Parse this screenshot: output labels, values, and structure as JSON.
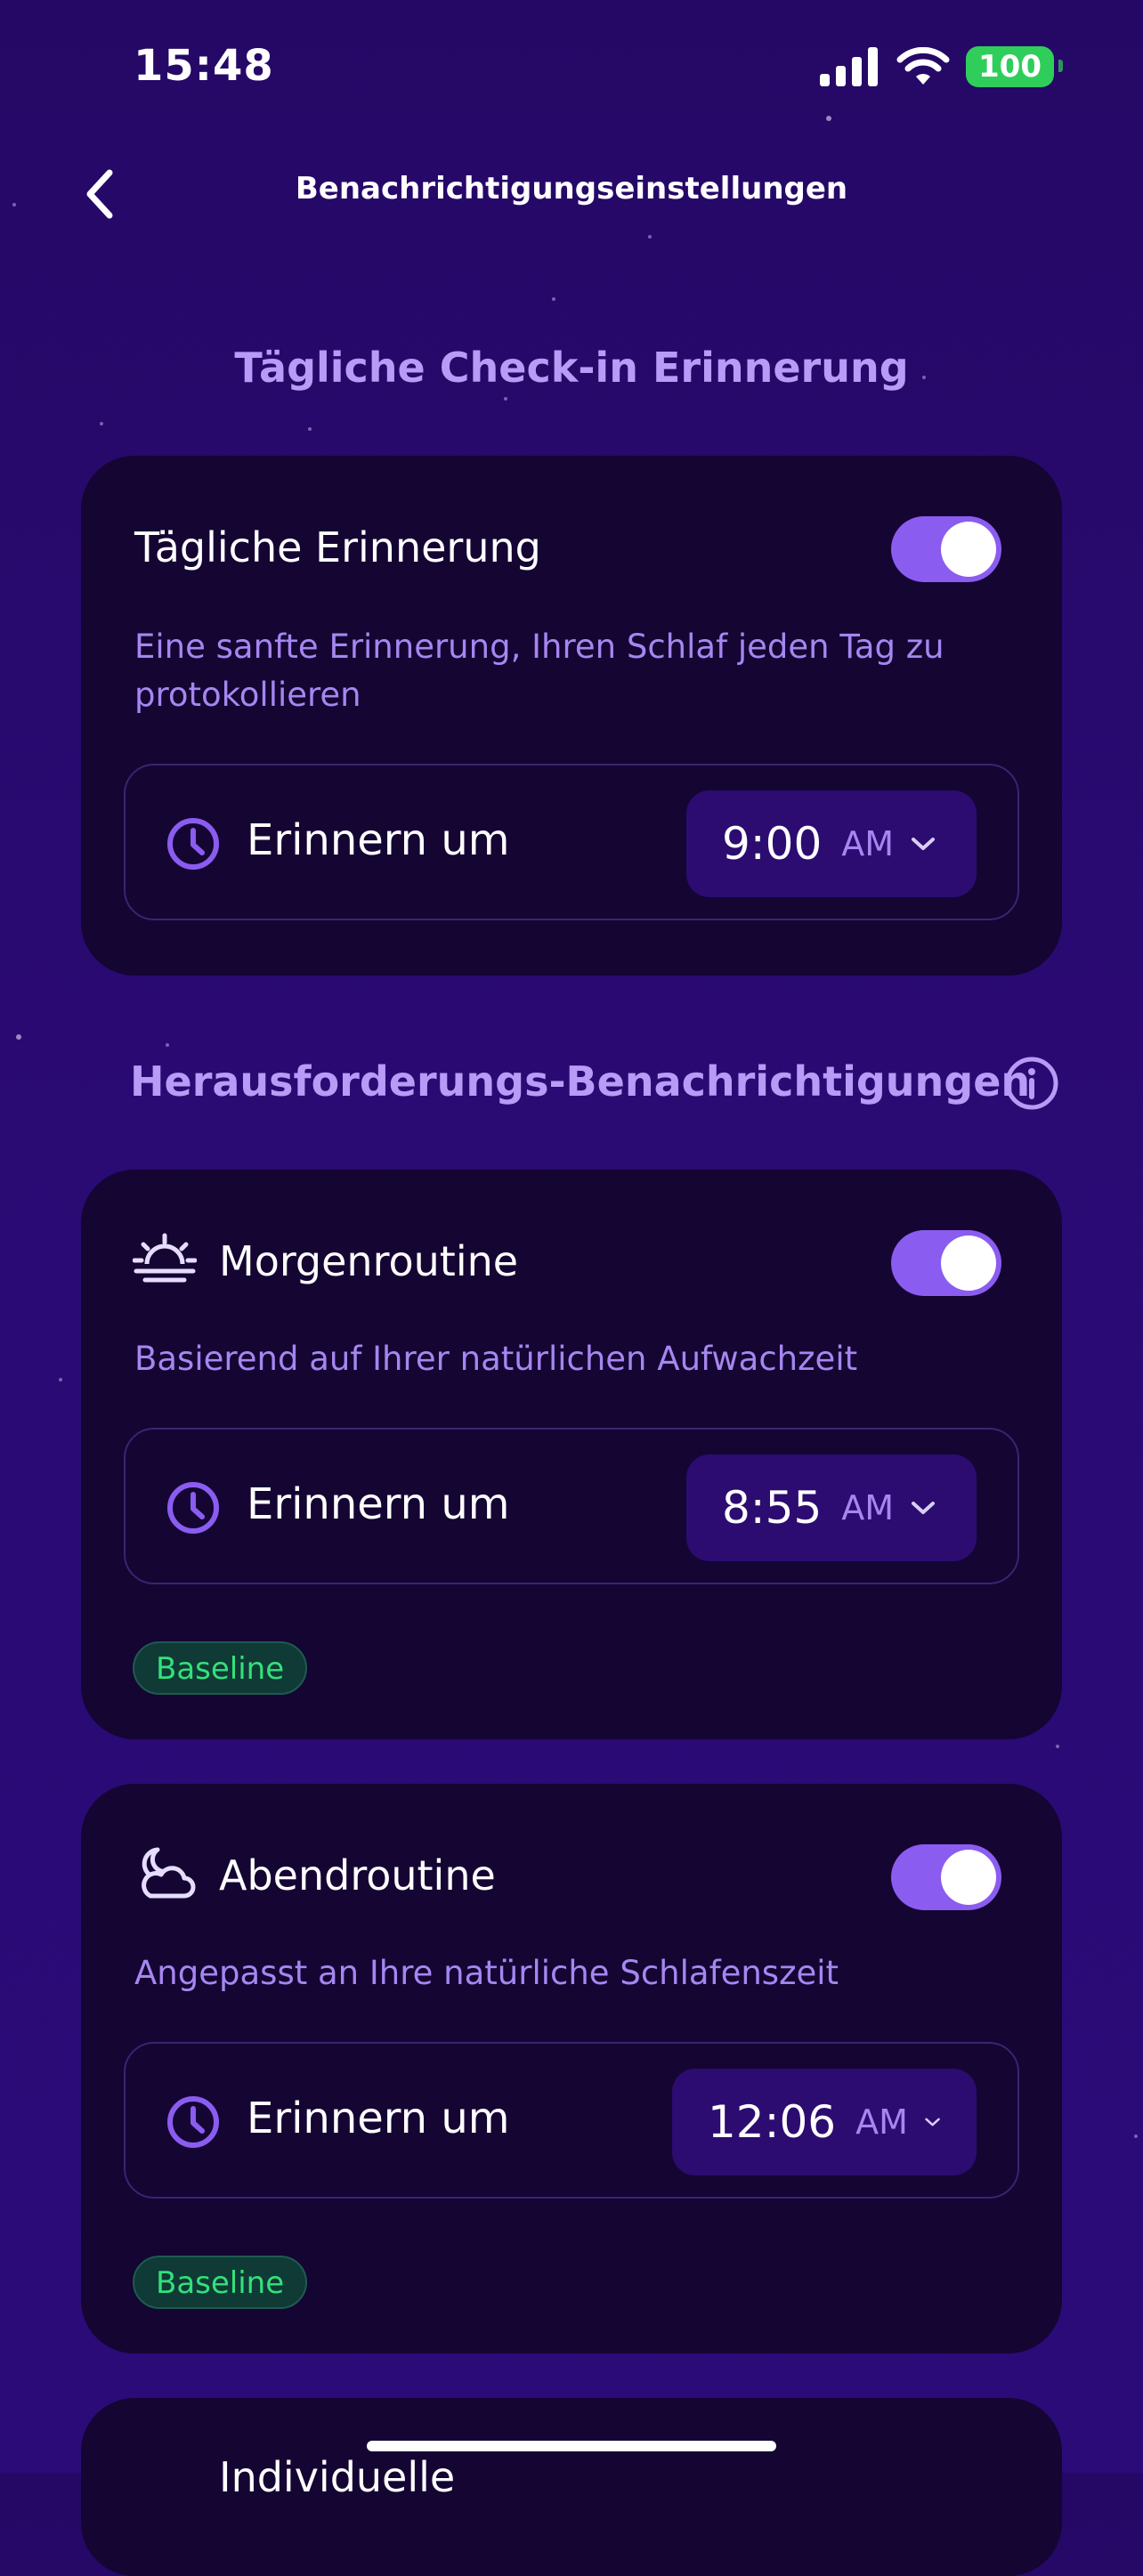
{
  "status_bar": {
    "time": "15:48",
    "battery": "100"
  },
  "nav": {
    "title": "Benachrichtigungseinstellungen"
  },
  "daily_section": {
    "title": "Tägliche Check-in Erinnerung",
    "card": {
      "title": "Tägliche Erinnerung",
      "description": "Eine sanfte Erinnerung, Ihren Schlaf jeden Tag zu protokollieren",
      "toggle_on": true,
      "remind_label": "Erinnern um",
      "time": "9:00",
      "ampm": "AM"
    }
  },
  "challenge_section": {
    "title": "Herausforderungs-Benachrichtigungen",
    "cards": [
      {
        "icon": "sunrise-icon",
        "title": "Morgenroutine",
        "description": "Basierend auf Ihrer natürlichen Aufwachzeit",
        "toggle_on": true,
        "remind_label": "Erinnern um",
        "time": "8:55",
        "ampm": "AM",
        "badge": "Baseline"
      },
      {
        "icon": "moon-cloud-icon",
        "title": "Abendroutine",
        "description": "Angepasst an Ihre natürliche Schlafenszeit",
        "toggle_on": true,
        "remind_label": "Erinnern um",
        "time": "12:06",
        "ampm": "AM",
        "badge": "Baseline"
      },
      {
        "title": "Individuelle"
      }
    ]
  },
  "colors": {
    "accent": "#8b5cf0",
    "background": "#2a0a73",
    "card": "#140533",
    "badge_text": "#34e07a"
  }
}
